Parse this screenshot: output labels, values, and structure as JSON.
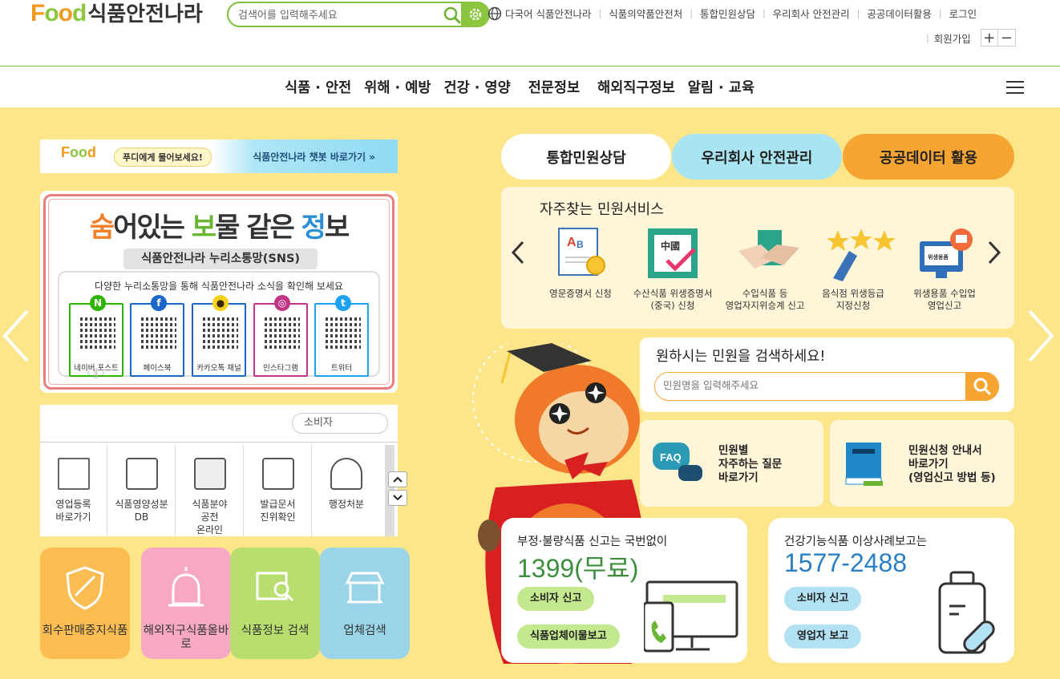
{
  "header": {
    "logo_food": "Food",
    "logo_site": "식품안전나라",
    "search_placeholder": "검색어를 입력해주세요",
    "utility_links": [
      "다국어 식품안전나라",
      "식품의약품안전처",
      "통합민원상담",
      "우리회사 안전관리",
      "공공데이터활용",
      "로그인"
    ],
    "signup": "회원가입",
    "zoom_in": "+",
    "zoom_out": "−"
  },
  "nav": [
    "식품 · 안전",
    "위해 · 예방",
    "건강 · 영양",
    "전문정보",
    "해외직구정보",
    "알림 · 교육"
  ],
  "left": {
    "chatbot_pill": "푸디에게 물어보세요!",
    "chatbot_link": "식품안전나라 챗봇 바로가기 »",
    "banner_title_parts": [
      "숨",
      "어있는 ",
      "보",
      "물 같은 ",
      "정",
      "보"
    ],
    "banner_subtitle": "식품안전나라 누리소통망(SNS)",
    "banner_desc": "다양한 누리소통망을 통해 식품안전나라 소식을 확인해 보세요",
    "sns": [
      {
        "label": "네이버 포스트",
        "icon": "N",
        "color": "#2db400"
      },
      {
        "label": "페이스북",
        "icon": "f",
        "color": "#1b66c9"
      },
      {
        "label": "카카오톡 채널",
        "icon": "●",
        "color": "#e6b800"
      },
      {
        "label": "인스타그램",
        "icon": "◎",
        "color": "#c13584"
      },
      {
        "label": "트위터",
        "icon": "t",
        "color": "#1da1f2"
      }
    ],
    "quick_tab": "소비자",
    "quick_items": [
      "영업등록\n바로가기",
      "식품영양성분\nDB",
      "식품분야\n공전\n온라인",
      "발급문서\n진위확인",
      "행정처분"
    ],
    "tiles": [
      {
        "label": "회수판매중지식품",
        "color": "#fbbd52"
      },
      {
        "label": "해외직구식품올바로",
        "color": "#f6a8c4"
      },
      {
        "label": "식품정보 검색",
        "color": "#b7de6f"
      },
      {
        "label": "업체검색",
        "color": "#9ad5e7"
      }
    ]
  },
  "right": {
    "tabs": [
      "통합민원상담",
      "우리회사 안전관리",
      "공공데이터 활용"
    ],
    "freq_title": "자주찾는 민원서비스",
    "services": [
      "영문증명서 신청",
      "수산식품 위생증명서\n(중국) 신청",
      "수입식품 등\n영업자지위승계 신고",
      "음식점 위생등급\n지정신청",
      "위생용품 수입업\n영업신고"
    ],
    "search_title": "원하시는 민원을 검색하세요!",
    "search_placeholder": "민원명을 입력해주세요",
    "faq_label": "FAQ",
    "faq_text": "민원별\n자주하는 질문\n바로가기",
    "guide_text": "민원신청 안내서\n바로가기\n(영업신고 방법 등)",
    "report1_title": "부정·불량식품 신고는 국번없이",
    "report1_number": "1399(무료)",
    "report1_buttons": [
      "소비자 신고",
      "식품업체이물보고"
    ],
    "report2_title": "건강기능식품 이상사례보고는",
    "report2_number": "1577-2488",
    "report2_buttons": [
      "소비자 신고",
      "영업자 보고"
    ]
  }
}
